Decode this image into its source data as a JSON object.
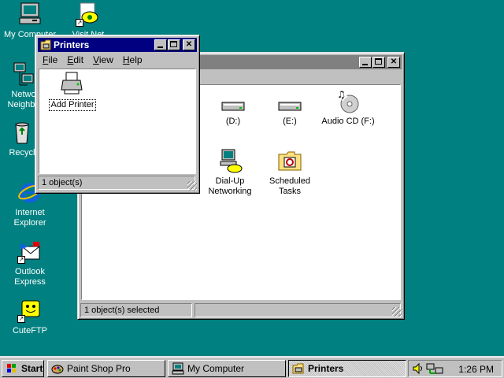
{
  "desktop": {
    "icons": [
      {
        "label": "My Computer"
      },
      {
        "label": "Visit Net"
      },
      {
        "label_line1": "Netwo",
        "label_line2": "Neighbo"
      },
      {
        "label": "Recycl"
      },
      {
        "label_line1": "Internet",
        "label_line2": "Explorer"
      },
      {
        "label_line1": "Outlook",
        "label_line2": "Express"
      },
      {
        "label": "CuteFTP"
      }
    ]
  },
  "my_computer_window": {
    "items": [
      {
        "label": "(D:)"
      },
      {
        "label": "(E:)"
      },
      {
        "label": "Audio CD (F:)"
      },
      {
        "label_line1": "Dial-Up",
        "label_line2": "Networking"
      },
      {
        "label_line1": "Scheduled",
        "label_line2": "Tasks"
      }
    ],
    "status": "1 object(s) selected"
  },
  "printers_window": {
    "title": "Printers",
    "menu": [
      {
        "key": "F",
        "rest": "ile"
      },
      {
        "key": "E",
        "rest": "dit"
      },
      {
        "key": "V",
        "rest": "iew"
      },
      {
        "key": "H",
        "rest": "elp"
      }
    ],
    "items": [
      {
        "label": "Add Printer"
      }
    ],
    "status": "1 object(s)"
  },
  "taskbar": {
    "start": "Start",
    "buttons": [
      {
        "label": "Paint Shop Pro"
      },
      {
        "label": "My Computer"
      },
      {
        "label": "Printers"
      }
    ],
    "clock": "1:26 PM"
  },
  "colors": {
    "desktop": "#008080",
    "titlebar_active": "#000080",
    "titlebar_inactive": "#808080",
    "face": "#c0c0c0"
  }
}
